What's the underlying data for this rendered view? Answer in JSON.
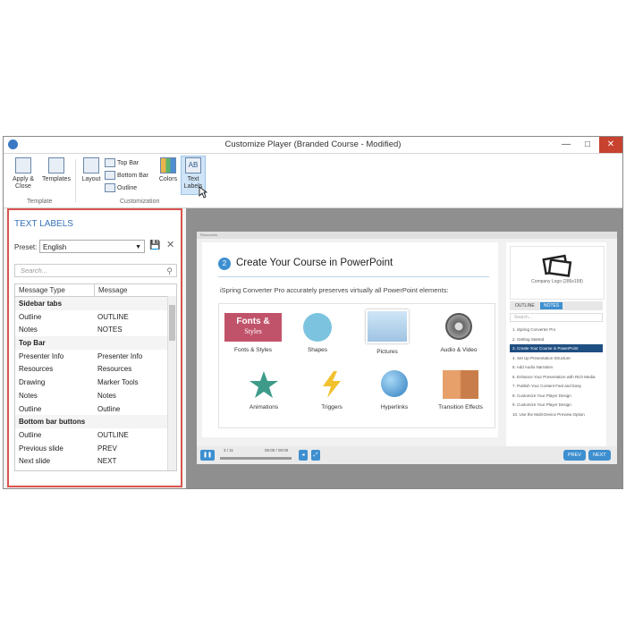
{
  "window": {
    "title": "Customize Player (Branded Course - Modified)"
  },
  "titlebar_buttons": {
    "minimize": "—",
    "maximize": "□",
    "close": "✕"
  },
  "ribbon": {
    "apply_close": "Apply & Close",
    "templates": "Templates",
    "group_template": "Template",
    "layout": "Layout",
    "top_bar": "Top Bar",
    "bottom_bar": "Bottom Bar",
    "outline": "Outline",
    "colors": "Colors",
    "text_labels": "Text Labels",
    "group_customization": "Customization"
  },
  "panel": {
    "title": "TEXT LABELS",
    "preset_label": "Preset:",
    "preset_value": "English",
    "search_placeholder": "Search...",
    "col_type": "Message Type",
    "col_message": "Message",
    "rows": [
      {
        "type": "Sidebar tabs",
        "message": "",
        "group": true
      },
      {
        "type": "Outline",
        "message": "OUTLINE",
        "group": false
      },
      {
        "type": "Notes",
        "message": "NOTES",
        "group": false
      },
      {
        "type": "Top Bar",
        "message": "",
        "group": true
      },
      {
        "type": "Presenter Info",
        "message": "Presenter Info",
        "group": false
      },
      {
        "type": "Resources",
        "message": "Resources",
        "group": false
      },
      {
        "type": "Drawing",
        "message": "Marker Tools",
        "group": false
      },
      {
        "type": "Notes",
        "message": "Notes",
        "group": false
      },
      {
        "type": "Outline",
        "message": "Outline",
        "group": false
      },
      {
        "type": "Bottom bar buttons",
        "message": "",
        "group": true
      },
      {
        "type": "Outline",
        "message": "OUTLINE",
        "group": false
      },
      {
        "type": "Previous slide",
        "message": "PREV",
        "group": false
      },
      {
        "type": "Next slide",
        "message": "NEXT",
        "group": false
      }
    ]
  },
  "slide": {
    "header": "Resources",
    "number": "2",
    "title": "Create Your Course in PowerPoint",
    "description": "iSpring Converter Pro accurately preserves virtually all PowerPoint elements:",
    "fonts_tile_line1": "Fonts &",
    "fonts_tile_line2": "Styles",
    "features": [
      "Fonts & Styles",
      "Shapes",
      "Pictures",
      "Audio & Video",
      "Animations",
      "Triggers",
      "Hyperlinks",
      "Transition Effects"
    ]
  },
  "player_sidebar": {
    "logo_text": "Company Logo (286x158)",
    "tab_outline": "OUTLINE",
    "tab_notes": "NOTES",
    "search": "Search...",
    "items": [
      "1. iSpring Converter Pro",
      "2. Getting Started",
      "3. Create Your Course in PowerPoint",
      "4. Set Up Presentation Structure",
      "5. Add Audio Narration",
      "6. Enhance Your Presentation with Rich Media",
      "7. Publish Your Content Fast and Easy",
      "8. Customize Your Player Design",
      "9. Customize Your Player Design",
      "10. Use the Multi-Device Preview Option"
    ],
    "selected_index": 2
  },
  "player_controls": {
    "slide_counter": "3 / 11",
    "time": "00:00 / 00:00",
    "prev": "PREV",
    "next": "NEXT"
  },
  "colors": {
    "accent": "#3d8fd0",
    "panel_border": "#d9534f",
    "close": "#c7422f"
  }
}
